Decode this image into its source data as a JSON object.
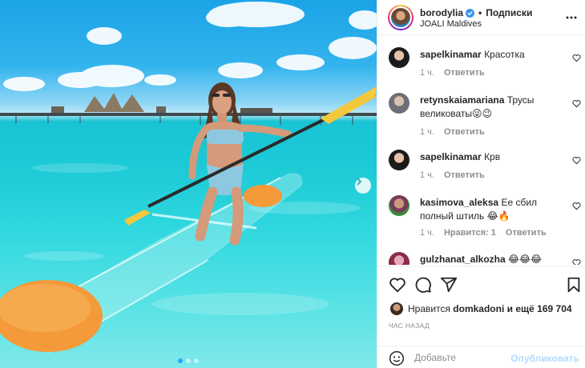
{
  "post": {
    "username": "borodylia",
    "separator": "•",
    "follow_label": "Подписки",
    "location": "JOALI Maldives"
  },
  "comments": [
    {
      "user": "sapelkinamar",
      "text": "Красотка",
      "time": "1 ч.",
      "likes": "",
      "reply": "Ответить"
    },
    {
      "user": "retynskaiamariana",
      "text": "Трусы великоваты😜😉",
      "time": "1 ч.",
      "likes": "",
      "reply": "Ответить"
    },
    {
      "user": "sapelkinamar",
      "text": "Крв",
      "time": "1 ч.",
      "likes": "",
      "reply": "Ответить"
    },
    {
      "user": "kasimova_aleksa",
      "text": "Ее сбил полный штиль 😂🔥",
      "time": "1 ч.",
      "likes": "Нравится: 1",
      "reply": "Ответить"
    },
    {
      "user": "gulzhanat_alkozha",
      "text": "😂😂😂",
      "time": "",
      "likes": "",
      "reply": ""
    }
  ],
  "likes": {
    "prefix": "Нравится",
    "user": "domkadoni",
    "suffix": "и ещё 169 704"
  },
  "time_ago": "ЧАС НАЗАД",
  "composer": {
    "placeholder": "Добавьте",
    "publish_label": "Опубликовать"
  },
  "icons": {
    "heart": "heart-icon",
    "comment": "comment-icon",
    "share": "share-icon",
    "save": "bookmark-icon",
    "emoji": "emoji-icon",
    "more": "more-icon",
    "next": "chevron-right-icon"
  },
  "colors": {
    "verified": "#3897f0",
    "publish_disabled": "#b3dbff",
    "carousel_active": "#2aa5f5"
  },
  "carousel": {
    "count": 3,
    "active_index": 0
  }
}
